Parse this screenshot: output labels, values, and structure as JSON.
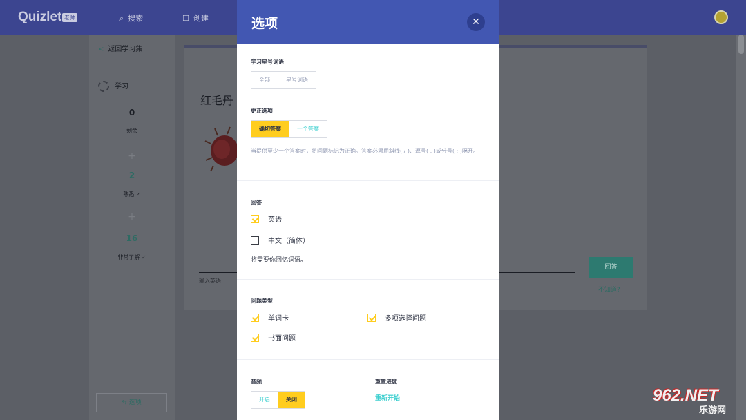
{
  "app": {
    "logo": "Quizlet",
    "badge": "老师"
  },
  "topnav": {
    "search": "搜索",
    "create": "创建"
  },
  "sidebar": {
    "back": "返回学习集",
    "mode": "学习",
    "stats": [
      {
        "value": "0",
        "label": "剩余"
      },
      {
        "value": "2",
        "label": "熟悉 ✓"
      },
      {
        "value": "16",
        "label": "非常了解 ✓"
      }
    ],
    "options_button": "选项"
  },
  "card": {
    "question": "红毛丹",
    "answer_hint": "输入英语",
    "answer_button": "回答",
    "dont_know": "不知道?"
  },
  "modal": {
    "title": "选项",
    "close_glyph": "✕",
    "study_starred": {
      "label": "学习星号词语",
      "options": [
        "全部",
        "星号词语"
      ]
    },
    "correction": {
      "label": "更正选项",
      "options": [
        "确切答案",
        "一个答案"
      ],
      "help": "当提供至少一个答案时，将问题标记为正确。答案必须用斜线( / )、逗号( , )或分号( ; )隔开。"
    },
    "answer": {
      "label": "回答",
      "items": [
        {
          "text": "英语",
          "checked": true
        },
        {
          "text": "中文（简体）",
          "checked": false
        }
      ],
      "note": "将需要你回忆词语。"
    },
    "question_types": {
      "label": "问题类型",
      "items": [
        {
          "text": "单词卡",
          "checked": true
        },
        {
          "text": "多项选择问题",
          "checked": true
        },
        {
          "text": "书面问题",
          "checked": true
        }
      ]
    },
    "audio": {
      "label": "音频",
      "options": [
        "开启",
        "关闭"
      ]
    },
    "reset": {
      "label": "重置进度",
      "action": "重新开始"
    }
  },
  "watermark": {
    "big": "962.NET",
    "small": "乐游网"
  }
}
